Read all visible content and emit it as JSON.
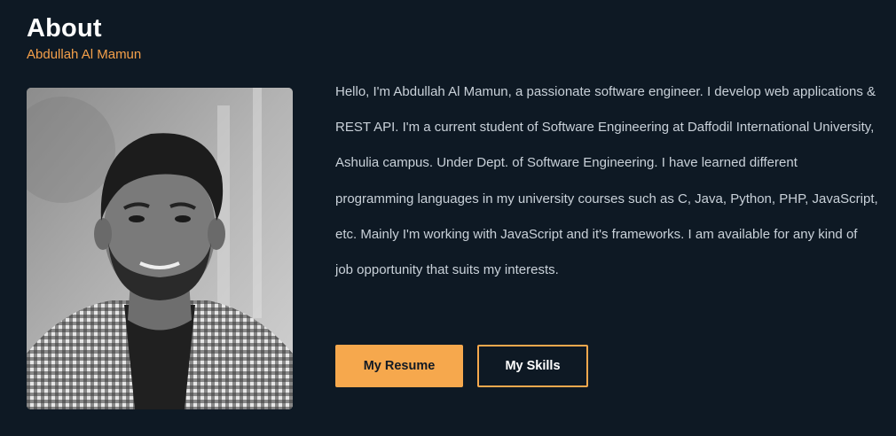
{
  "about": {
    "title": "About",
    "name": "Abdullah Al Mamun",
    "photo_alt": "Abdullah Al Mamun",
    "bio": "Hello, I'm Abdullah Al Mamun, a passionate software engineer. I develop web applications & REST API. I'm a current student of Software Engineering at Daffodil International University, Ashulia campus. Under Dept. of Software Engineering. I have learned different programming languages in my university courses such as C, Java, Python, PHP, JavaScript, etc. Mainly I'm working with JavaScript and it's frameworks. I am available for any kind of job opportunity that suits my interests.",
    "buttons": {
      "resume_label": "My Resume",
      "skills_label": "My Skills"
    }
  },
  "colors": {
    "background": "#0e1924",
    "accent": "#f6a84d",
    "text": "#c9d1d9",
    "heading": "#ffffff"
  }
}
